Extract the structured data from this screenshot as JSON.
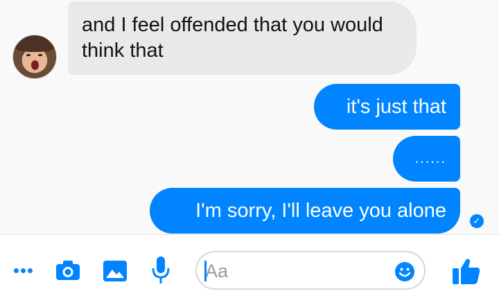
{
  "thread": {
    "incoming": [
      {
        "text": "and I feel offended that you would think that"
      }
    ],
    "outgoing": [
      {
        "text": "it's just that"
      },
      {
        "text": "......"
      },
      {
        "text": "I'm sorry, I'll leave you alone"
      }
    ],
    "seen_icon": "seen-check-icon",
    "avatar_icon": "contact-avatar"
  },
  "composer": {
    "placeholder": "Aa",
    "value": "",
    "icons": [
      "more-icon",
      "camera-icon",
      "image-icon",
      "microphone-icon",
      "emoji-icon",
      "thumbs-up-icon"
    ]
  },
  "colors": {
    "accent": "#0084ff",
    "incoming_bubble": "#e9e9e9",
    "background": "#f9f9f9"
  }
}
